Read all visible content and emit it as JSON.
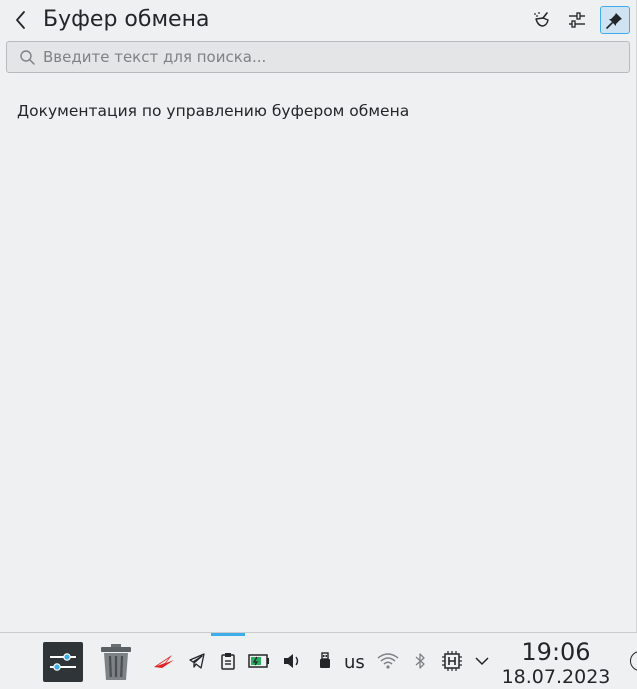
{
  "popup": {
    "title": "Буфер обмена",
    "search_placeholder": "Введите текст для поиска...",
    "search_value": "",
    "documentation_link": "Документация по управлению буфером обмена",
    "toolbar": {
      "back_icon": "back-arrow-icon",
      "clear_icon": "clear-history-icon",
      "configure_icon": "configure-icon",
      "pin_icon": "pin-icon",
      "pinned": true
    }
  },
  "panel": {
    "tasks": [
      "system-settings-icon",
      "trash-icon"
    ],
    "tray_icons": [
      "rog-icon",
      "telegram-icon",
      "clipboard-icon",
      "battery-icon",
      "volume-icon",
      "usb-icon",
      "wifi-icon",
      "bluetooth-icon",
      "cpu-monitor-icon",
      "expand-tray-icon"
    ],
    "keyboard_layout": "us",
    "clock": {
      "time": "19:06",
      "date": "18.07.2023"
    },
    "accent_color": "#3daee9"
  }
}
